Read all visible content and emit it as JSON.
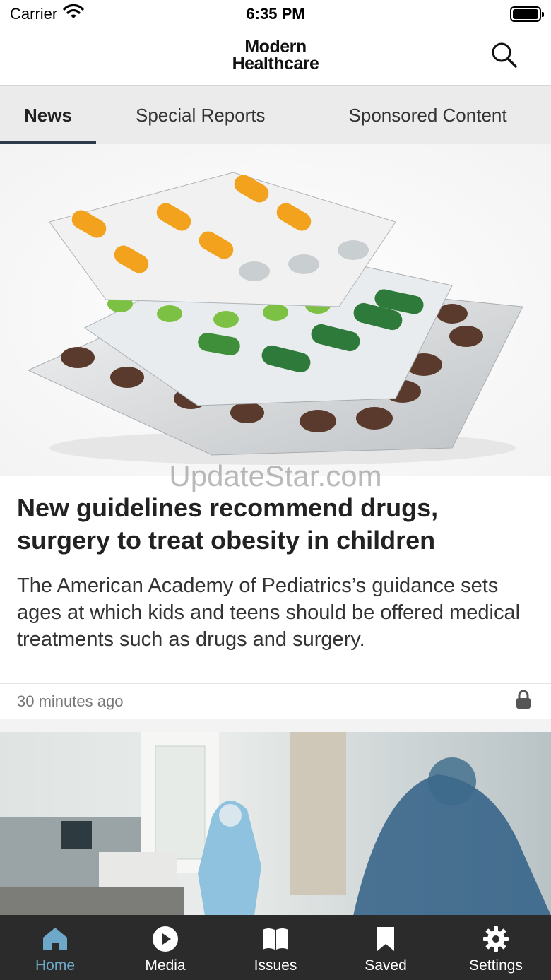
{
  "status_bar": {
    "carrier": "Carrier",
    "time": "6:35 PM"
  },
  "header": {
    "logo_line1": "Modern",
    "logo_line2": "Healthcare"
  },
  "tabs": [
    {
      "label": "News",
      "active": true
    },
    {
      "label": "Special Reports",
      "active": false
    },
    {
      "label": "Sponsored Content",
      "active": false
    }
  ],
  "feed": {
    "watermark": "UpdateStar.com",
    "articles": [
      {
        "headline": "New guidelines recommend drugs, surgery to treat obesity in children",
        "summary": "The American Academy of Pediatrics’s guidance sets ages at which kids and teens should be offered medical treatments such as drugs and surgery.",
        "time": "30 minutes ago",
        "locked": true
      }
    ]
  },
  "tab_bar": [
    {
      "label": "Home",
      "icon": "home-icon",
      "active": true
    },
    {
      "label": "Media",
      "icon": "play-icon",
      "active": false
    },
    {
      "label": "Issues",
      "icon": "book-icon",
      "active": false
    },
    {
      "label": "Saved",
      "icon": "bookmark-icon",
      "active": false
    },
    {
      "label": "Settings",
      "icon": "gear-icon",
      "active": false
    }
  ],
  "colors": {
    "accent": "#6ea8c8",
    "tab_bar_bg": "#2b2b2b",
    "tab_indicator": "#2d3a4a"
  }
}
